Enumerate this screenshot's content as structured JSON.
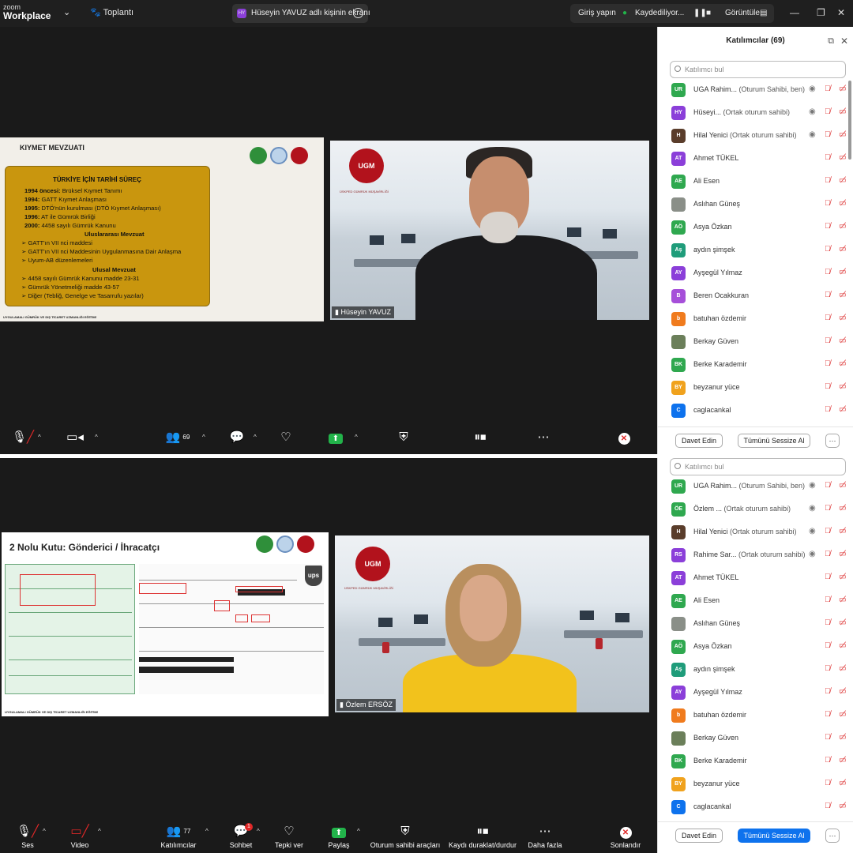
{
  "titlebar": {
    "brand_top": "zoom",
    "brand_bottom": "Workplace",
    "meeting_label": "Toplantı",
    "share_initials": "HY",
    "share_text": "Hüseyin YAVUZ adlı kişinin ekranı",
    "signin": "Giriş yapın",
    "recording": "Kaydediliyor...",
    "view": "Görüntüle"
  },
  "slide1": {
    "title": "KIYMET MEVZUATI",
    "scroll_header": "TÜRKİYE İÇİN TARİHİ SÜREÇ",
    "history": [
      {
        "year": "1994 öncesi:",
        "text": " Brüksel Kıymet Tanımı"
      },
      {
        "year": "1994:",
        "text": " GATT Kıymet Anlaşması"
      },
      {
        "year": "1995:",
        "text": " DTÖ'nün kurulması (DTÖ Kıymet Anlaşması)"
      },
      {
        "year": "1996:",
        "text": " AT ile Gümrük Birliği"
      },
      {
        "year": "2000:",
        "text": " 4458 sayılı Gümrük Kanunu"
      }
    ],
    "intl_header": "Uluslararası Mevzuat",
    "intl": [
      "GATT'ın VII nci maddesi",
      "GATT'ın VII nci Maddesinin Uygulanmasına Dair Anlaşma",
      "Uyum-AB düzenlemeleri"
    ],
    "national_header": "Ulusal Mevzuat",
    "national": [
      "4458 sayılı Gümrük Kanunu madde 23-31",
      "Gümrük Yönetmeliği madde 43-57",
      "Diğer (Tebliğ, Genelge ve Tasarrufu yazılar)"
    ],
    "footer": "UYGULAMALI GÜMRÜK VE DIŞ TİCARET UZMANLIĞI EĞİTİMİ"
  },
  "slide2": {
    "title": "2 Nolu Kutu: Gönderici / İhracatçı",
    "ups": "ups",
    "footer": "UYGULAMALI GÜMRÜK VE DIŞ TİCARET UZMANLIĞI EĞİTİMİ"
  },
  "video1": {
    "seal": "UGM",
    "caption": "ÜSKPED GÜMRÜK MÜŞAVİRLİĞİ",
    "name": "Hüseyin YAVUZ"
  },
  "video2": {
    "seal": "UGM",
    "caption": "ÜSKPED GÜMRÜK MÜŞAVİRLİĞİ",
    "name": "Özlem ERSÖZ"
  },
  "panel1": {
    "title": "Katılımcılar (69)",
    "search_placeholder": "Katılımcı bul",
    "invite": "Davet Edin",
    "mute_all": "Tümünü Sessize Al",
    "more": "···",
    "participants": [
      {
        "initials": "UR",
        "color": "#2fa84f",
        "name": "UGA Rahim...",
        "role": " (Oturum Sahibi, ben)"
      },
      {
        "initials": "HY",
        "color": "#8b3fd9",
        "name": "Hüseyi...",
        "role": " (Ortak oturum sahibi)"
      },
      {
        "initials": "H",
        "color": "#5a3d2b",
        "name": "Hilal Yenici",
        "role": " (Ortak oturum sahibi)"
      },
      {
        "initials": "AT",
        "color": "#8b3fd9",
        "name": "Ahmet TÜKEL",
        "role": ""
      },
      {
        "initials": "AE",
        "color": "#2fa84f",
        "name": "Ali Esen",
        "role": ""
      },
      {
        "initials": "",
        "color": "#8a8f88",
        "name": "Aslıhan Güneş",
        "role": ""
      },
      {
        "initials": "AÖ",
        "color": "#2fa84f",
        "name": "Asya Özkan",
        "role": ""
      },
      {
        "initials": "Aş",
        "color": "#1f9c7a",
        "name": "aydın şimşek",
        "role": ""
      },
      {
        "initials": "AY",
        "color": "#8b3fd9",
        "name": "Ayşegül Yılmaz",
        "role": ""
      },
      {
        "initials": "B",
        "color": "#a64fd9",
        "name": "Beren Ocakkuran",
        "role": ""
      },
      {
        "initials": "b",
        "color": "#f07b1d",
        "name": "batuhan özdemir",
        "role": ""
      },
      {
        "initials": "",
        "color": "#6b7f5a",
        "name": "Berkay Güven",
        "role": ""
      },
      {
        "initials": "BK",
        "color": "#2fa84f",
        "name": "Berke Karademir",
        "role": ""
      },
      {
        "initials": "BY",
        "color": "#f0a21d",
        "name": "beyzanur yüce",
        "role": ""
      },
      {
        "initials": "C",
        "color": "#0e72ed",
        "name": "caglacankal",
        "role": ""
      }
    ]
  },
  "panel2": {
    "search_placeholder": "Katılımcı bul",
    "invite": "Davet Edin",
    "mute_all": "Tümünü Sessize Al",
    "more": "···",
    "participants": [
      {
        "initials": "UR",
        "color": "#2fa84f",
        "name": "UGA Rahim...",
        "role": " (Oturum Sahibi, ben)"
      },
      {
        "initials": "ÖE",
        "color": "#2fa84f",
        "name": "Özlem ...",
        "role": " (Ortak oturum sahibi)"
      },
      {
        "initials": "H",
        "color": "#5a3d2b",
        "name": "Hilal Yenici",
        "role": " (Ortak oturum sahibi)"
      },
      {
        "initials": "RS",
        "color": "#8b3fd9",
        "name": "Rahime Sar...",
        "role": " (Ortak oturum sahibi)"
      },
      {
        "initials": "AT",
        "color": "#8b3fd9",
        "name": "Ahmet TÜKEL",
        "role": ""
      },
      {
        "initials": "AE",
        "color": "#2fa84f",
        "name": "Ali Esen",
        "role": ""
      },
      {
        "initials": "",
        "color": "#8a8f88",
        "name": "Aslıhan Güneş",
        "role": ""
      },
      {
        "initials": "AÖ",
        "color": "#2fa84f",
        "name": "Asya Özkan",
        "role": ""
      },
      {
        "initials": "Aş",
        "color": "#1f9c7a",
        "name": "aydın şimşek",
        "role": ""
      },
      {
        "initials": "AY",
        "color": "#8b3fd9",
        "name": "Ayşegül Yılmaz",
        "role": ""
      },
      {
        "initials": "b",
        "color": "#f07b1d",
        "name": "batuhan özdemir",
        "role": ""
      },
      {
        "initials": "",
        "color": "#6b7f5a",
        "name": "Berkay Güven",
        "role": ""
      },
      {
        "initials": "BK",
        "color": "#2fa84f",
        "name": "Berke Karademir",
        "role": ""
      },
      {
        "initials": "BY",
        "color": "#f0a21d",
        "name": "beyzanur yüce",
        "role": ""
      },
      {
        "initials": "C",
        "color": "#0e72ed",
        "name": "caglacankal",
        "role": ""
      }
    ]
  },
  "toolbar1": {
    "participants_count": "69"
  },
  "toolbar2": {
    "audio": "Ses",
    "video": "Video",
    "participants": "Katılımcılar",
    "participants_count": "77",
    "chat": "Sohbet",
    "chat_badge": "1",
    "react": "Tepki ver",
    "share": "Paylaş",
    "host_tools": "Oturum sahibi araçları",
    "record": "Kaydı duraklat/durdur",
    "more": "Daha fazla",
    "end": "Sonlandır"
  }
}
